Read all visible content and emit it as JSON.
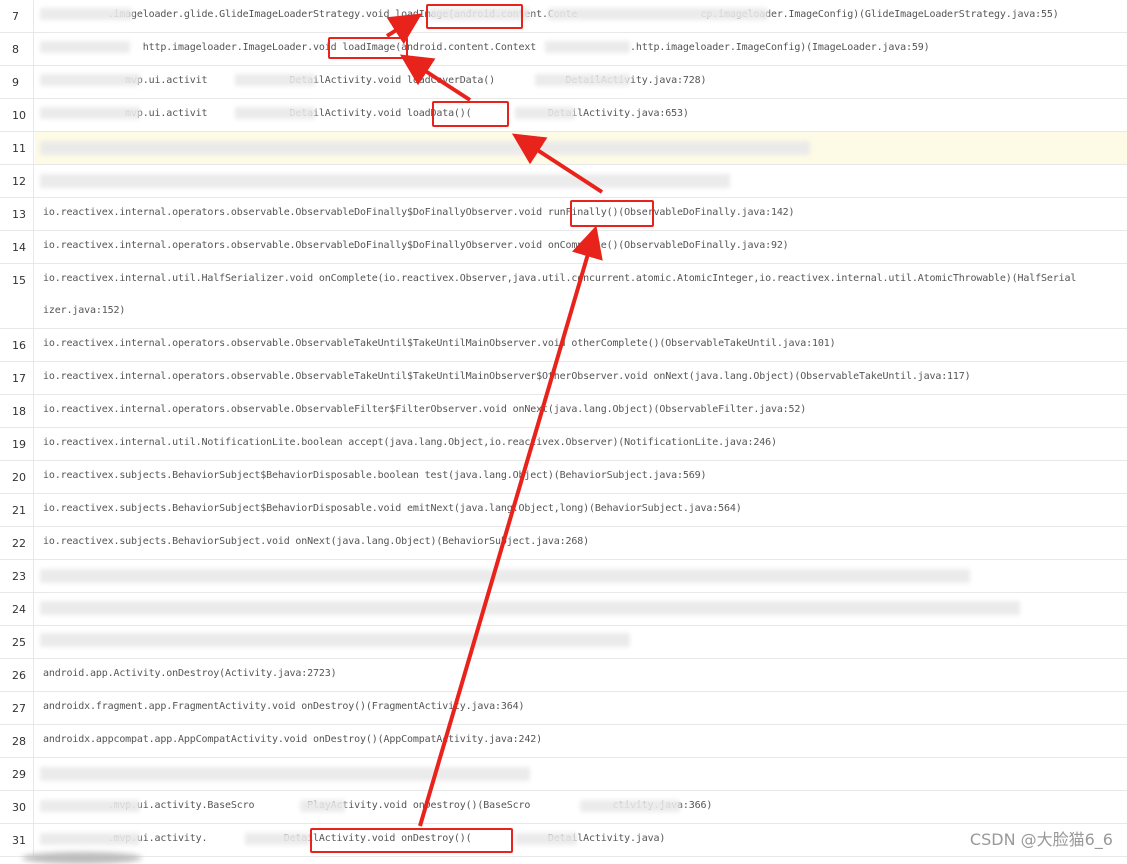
{
  "rows": [
    {
      "n": "7",
      "text": "           .imageloader.glide.GlideImageLoaderStrategy.void loadImage(android.content.Conte                     cp.imageloader.ImageConfig)(GlideImageLoaderStrategy.java:55)"
    },
    {
      "n": "8",
      "text": "                 http.imageloader.ImageLoader.void loadImage(android.content.Context                .http.imageloader.ImageConfig)(ImageLoader.java:59)"
    },
    {
      "n": "9",
      "text": "              mvp.ui.activit              DetailActivity.void loadCoverData()            DetailActivity.java:728)"
    },
    {
      "n": "10",
      "text": "              mvp.ui.activit              DetailActivity.void loadData()(             DetailActivity.java:653)"
    },
    {
      "n": "11",
      "text": ""
    },
    {
      "n": "12",
      "text": ""
    },
    {
      "n": "13",
      "text": "io.reactivex.internal.operators.observable.ObservableDoFinally$DoFinallyObserver.void runFinally()(ObservableDoFinally.java:142)"
    },
    {
      "n": "14",
      "text": "io.reactivex.internal.operators.observable.ObservableDoFinally$DoFinallyObserver.void onComplete()(ObservableDoFinally.java:92)"
    },
    {
      "n": "15",
      "text": "io.reactivex.internal.util.HalfSerializer.void onComplete(io.reactivex.Observer,java.util.concurrent.atomic.AtomicInteger,io.reactivex.internal.util.AtomicThrowable)(HalfSerial",
      "text2": "izer.java:152)"
    },
    {
      "n": "16",
      "text": "io.reactivex.internal.operators.observable.ObservableTakeUntil$TakeUntilMainObserver.void otherComplete()(ObservableTakeUntil.java:101)"
    },
    {
      "n": "17",
      "text": "io.reactivex.internal.operators.observable.ObservableTakeUntil$TakeUntilMainObserver$OtherObserver.void onNext(java.lang.Object)(ObservableTakeUntil.java:117)"
    },
    {
      "n": "18",
      "text": "io.reactivex.internal.operators.observable.ObservableFilter$FilterObserver.void onNext(java.lang.Object)(ObservableFilter.java:52)"
    },
    {
      "n": "19",
      "text": "io.reactivex.internal.util.NotificationLite.boolean accept(java.lang.Object,io.reactivex.Observer)(NotificationLite.java:246)"
    },
    {
      "n": "20",
      "text": "io.reactivex.subjects.BehaviorSubject$BehaviorDisposable.boolean test(java.lang.Object)(BehaviorSubject.java:569)"
    },
    {
      "n": "21",
      "text": "io.reactivex.subjects.BehaviorSubject$BehaviorDisposable.void emitNext(java.lang.Object,long)(BehaviorSubject.java:564)"
    },
    {
      "n": "22",
      "text": "io.reactivex.subjects.BehaviorSubject.void onNext(java.lang.Object)(BehaviorSubject.java:268)"
    },
    {
      "n": "23",
      "text": ""
    },
    {
      "n": "24",
      "text": ""
    },
    {
      "n": "25",
      "text": ""
    },
    {
      "n": "26",
      "text": "android.app.Activity.onDestroy(Activity.java:2723)"
    },
    {
      "n": "27",
      "text": "androidx.fragment.app.FragmentActivity.void onDestroy()(FragmentActivity.java:364)"
    },
    {
      "n": "28",
      "text": "androidx.appcompat.app.AppCompatActivity.void onDestroy()(AppCompatActivity.java:242)"
    },
    {
      "n": "29",
      "text": ""
    },
    {
      "n": "30",
      "text": "           .mvp.ui.activity.BaseScro         PlayActivity.void onDestroy()(BaseScro              ctivity.java:366)"
    },
    {
      "n": "31",
      "text": "           .mvp.ui.activity.             DetailActivity.void onDestroy()(             DetailActivity.java)"
    }
  ],
  "watermark": "CSDN @大脸猫6_6",
  "colors": {
    "annotation": "#e8231b",
    "highlight_row": "#fdfbe6",
    "border": "#e8e8e8"
  }
}
